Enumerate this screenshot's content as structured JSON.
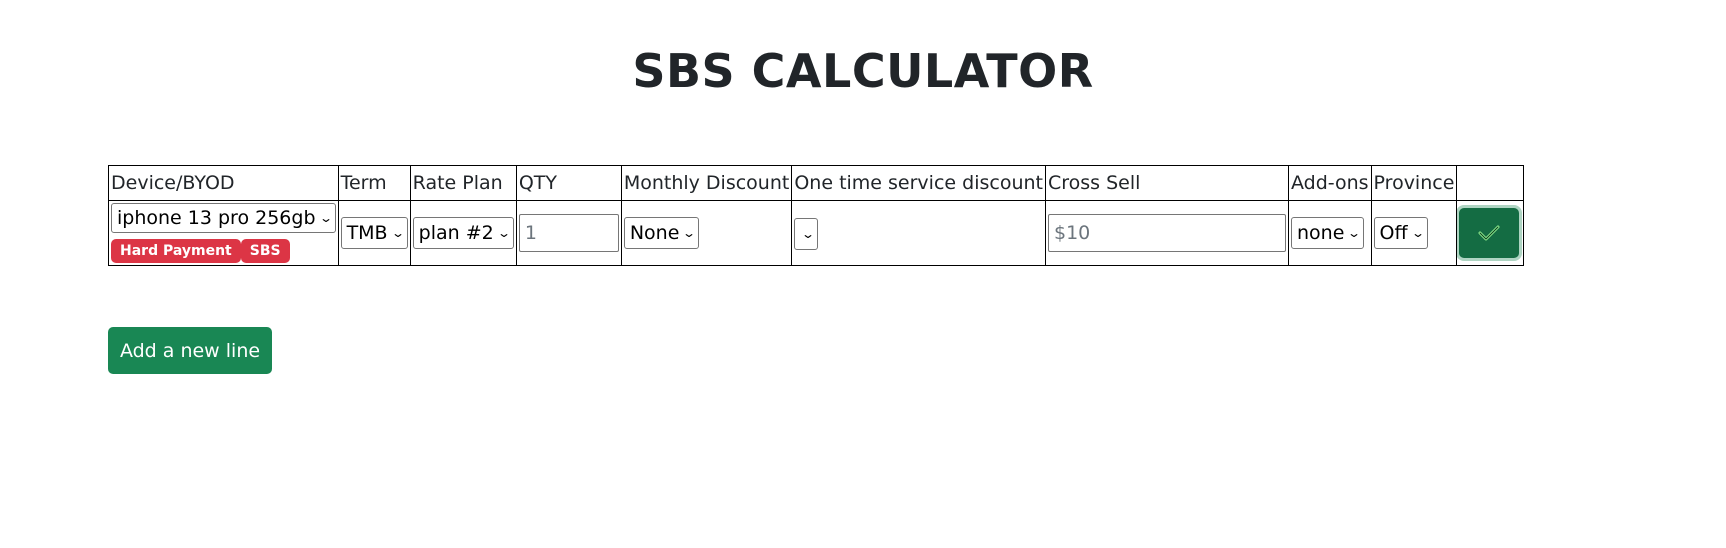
{
  "page": {
    "title": "SBS CALCULATOR"
  },
  "table": {
    "headers": [
      "Device/BYOD",
      "Term",
      "Rate Plan",
      "QTY",
      "Monthly Discount",
      "One time service discount",
      "Cross Sell",
      "Add-ons",
      "Province",
      ""
    ],
    "row": {
      "device": "iphone 13 pro 256gb",
      "badges": [
        "Hard Payment",
        "SBS"
      ],
      "term": "TMB",
      "rate_plan": "plan #2",
      "qty_placeholder": "1",
      "monthly_discount": "None",
      "one_time_discount": "",
      "cross_sell_placeholder": "$10",
      "addons": "none",
      "province": "Off"
    }
  },
  "actions": {
    "add_line": "Add a new line"
  },
  "colors": {
    "success": "#198754",
    "success_dark": "#146c43",
    "danger": "#dc3545",
    "check": "#90ee90"
  }
}
